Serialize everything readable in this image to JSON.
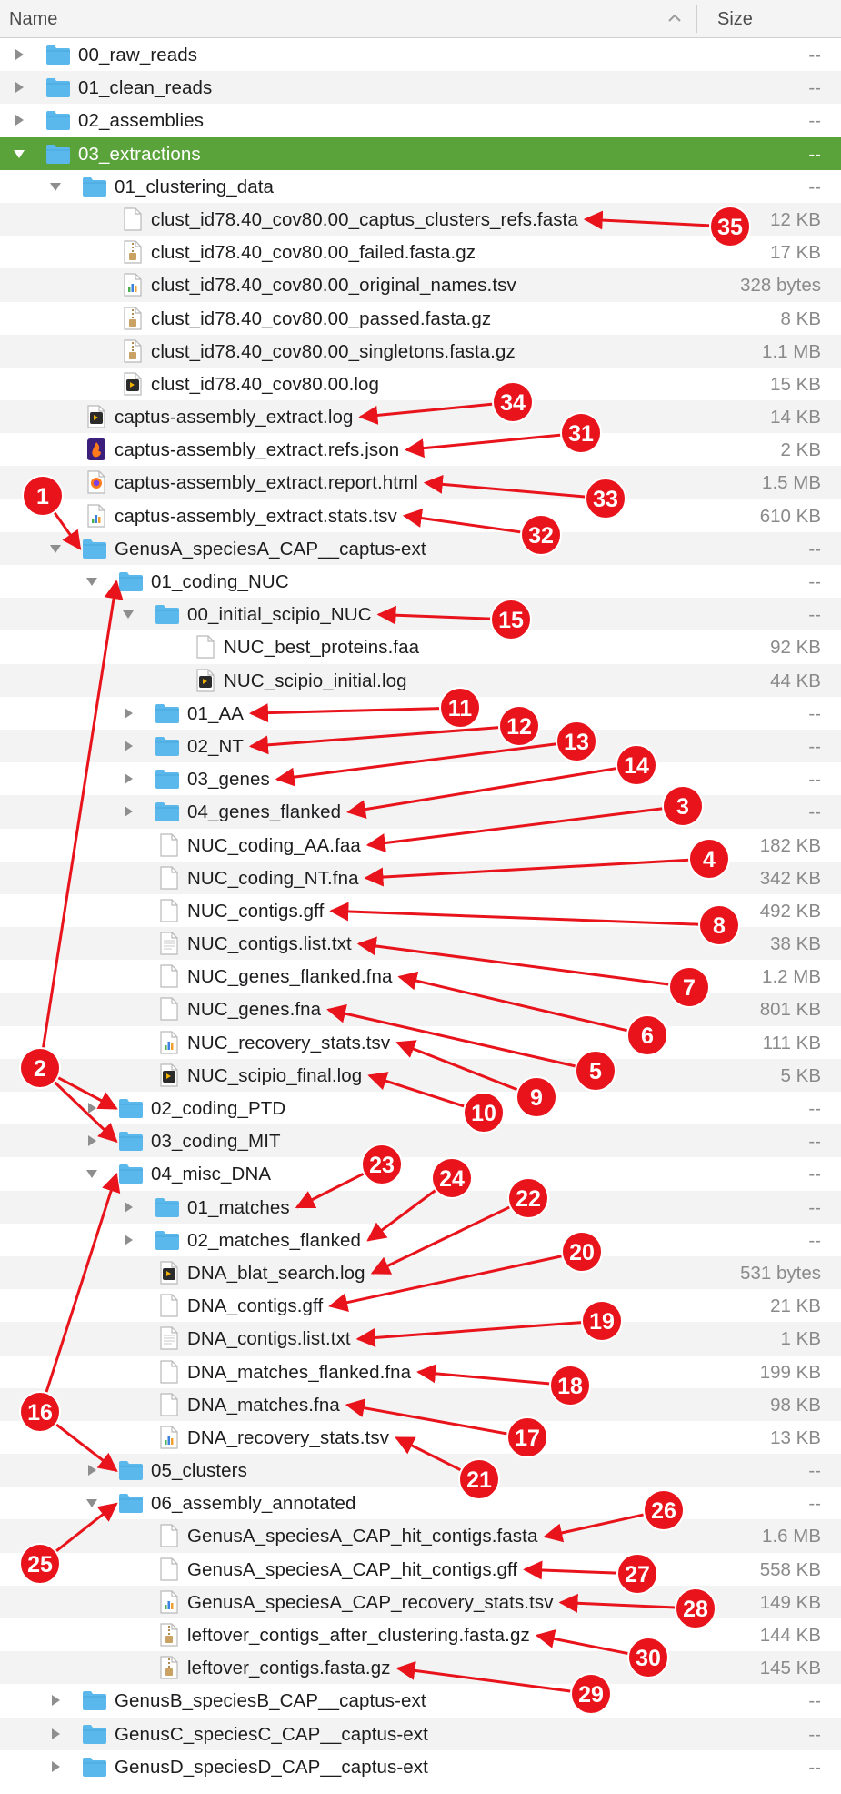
{
  "header": {
    "name_label": "Name",
    "size_label": "Size"
  },
  "colors": {
    "selection": "#5aa33b",
    "folder": "#5ab8ec",
    "badge": "#e8131b",
    "arrow": "#e8131b"
  },
  "rows": [
    {
      "name": "00_raw_reads",
      "size": "--",
      "type": "folder",
      "level": 0,
      "disc": "closed"
    },
    {
      "name": "01_clean_reads",
      "size": "--",
      "type": "folder",
      "level": 0,
      "disc": "closed"
    },
    {
      "name": "02_assemblies",
      "size": "--",
      "type": "folder",
      "level": 0,
      "disc": "closed"
    },
    {
      "name": "03_extractions",
      "size": "--",
      "type": "folder",
      "level": 0,
      "disc": "open",
      "selected": true
    },
    {
      "name": "01_clustering_data",
      "size": "--",
      "type": "folder",
      "level": 1,
      "disc": "open"
    },
    {
      "name": "clust_id78.40_cov80.00_captus_clusters_refs.fasta",
      "size": "12 KB",
      "type": "doc",
      "level": 2,
      "disc": "none"
    },
    {
      "name": "clust_id78.40_cov80.00_failed.fasta.gz",
      "size": "17 KB",
      "type": "archive",
      "level": 2,
      "disc": "none"
    },
    {
      "name": "clust_id78.40_cov80.00_original_names.tsv",
      "size": "328 bytes",
      "type": "table",
      "level": 2,
      "disc": "none"
    },
    {
      "name": "clust_id78.40_cov80.00_passed.fasta.gz",
      "size": "8 KB",
      "type": "archive",
      "level": 2,
      "disc": "none"
    },
    {
      "name": "clust_id78.40_cov80.00_singletons.fasta.gz",
      "size": "1.1 MB",
      "type": "archive",
      "level": 2,
      "disc": "none"
    },
    {
      "name": "clust_id78.40_cov80.00.log",
      "size": "15 KB",
      "type": "log",
      "level": 2,
      "disc": "none"
    },
    {
      "name": "captus-assembly_extract.log",
      "size": "14 KB",
      "type": "log",
      "level": 1,
      "disc": "none"
    },
    {
      "name": "captus-assembly_extract.refs.json",
      "size": "2 KB",
      "type": "json",
      "level": 1,
      "disc": "none"
    },
    {
      "name": "captus-assembly_extract.report.html",
      "size": "1.5 MB",
      "type": "html",
      "level": 1,
      "disc": "none"
    },
    {
      "name": "captus-assembly_extract.stats.tsv",
      "size": "610 KB",
      "type": "table",
      "level": 1,
      "disc": "none"
    },
    {
      "name": "GenusA_speciesA_CAP__captus-ext",
      "size": "--",
      "type": "folder",
      "level": 1,
      "disc": "open"
    },
    {
      "name": "01_coding_NUC",
      "size": "--",
      "type": "folder",
      "level": 2,
      "disc": "open"
    },
    {
      "name": "00_initial_scipio_NUC",
      "size": "--",
      "type": "folder",
      "level": 3,
      "disc": "open"
    },
    {
      "name": "NUC_best_proteins.faa",
      "size": "92 KB",
      "type": "doc",
      "level": 4,
      "disc": "none"
    },
    {
      "name": "NUC_scipio_initial.log",
      "size": "44 KB",
      "type": "log",
      "level": 4,
      "disc": "none"
    },
    {
      "name": "01_AA",
      "size": "--",
      "type": "folder",
      "level": 3,
      "disc": "closed"
    },
    {
      "name": "02_NT",
      "size": "--",
      "type": "folder",
      "level": 3,
      "disc": "closed"
    },
    {
      "name": "03_genes",
      "size": "--",
      "type": "folder",
      "level": 3,
      "disc": "closed"
    },
    {
      "name": "04_genes_flanked",
      "size": "--",
      "type": "folder",
      "level": 3,
      "disc": "closed"
    },
    {
      "name": "NUC_coding_AA.faa",
      "size": "182 KB",
      "type": "doc",
      "level": 3,
      "disc": "none"
    },
    {
      "name": "NUC_coding_NT.fna",
      "size": "342 KB",
      "type": "doc",
      "level": 3,
      "disc": "none"
    },
    {
      "name": "NUC_contigs.gff",
      "size": "492 KB",
      "type": "doc",
      "level": 3,
      "disc": "none"
    },
    {
      "name": "NUC_contigs.list.txt",
      "size": "38 KB",
      "type": "text",
      "level": 3,
      "disc": "none"
    },
    {
      "name": "NUC_genes_flanked.fna",
      "size": "1.2 MB",
      "type": "doc",
      "level": 3,
      "disc": "none"
    },
    {
      "name": "NUC_genes.fna",
      "size": "801 KB",
      "type": "doc",
      "level": 3,
      "disc": "none"
    },
    {
      "name": "NUC_recovery_stats.tsv",
      "size": "111 KB",
      "type": "table",
      "level": 3,
      "disc": "none"
    },
    {
      "name": "NUC_scipio_final.log",
      "size": "5 KB",
      "type": "log",
      "level": 3,
      "disc": "none"
    },
    {
      "name": "02_coding_PTD",
      "size": "--",
      "type": "folder",
      "level": 2,
      "disc": "closed"
    },
    {
      "name": "03_coding_MIT",
      "size": "--",
      "type": "folder",
      "level": 2,
      "disc": "closed"
    },
    {
      "name": "04_misc_DNA",
      "size": "--",
      "type": "folder",
      "level": 2,
      "disc": "open"
    },
    {
      "name": "01_matches",
      "size": "--",
      "type": "folder",
      "level": 3,
      "disc": "closed"
    },
    {
      "name": "02_matches_flanked",
      "size": "--",
      "type": "folder",
      "level": 3,
      "disc": "closed"
    },
    {
      "name": "DNA_blat_search.log",
      "size": "531 bytes",
      "type": "log",
      "level": 3,
      "disc": "none"
    },
    {
      "name": "DNA_contigs.gff",
      "size": "21 KB",
      "type": "doc",
      "level": 3,
      "disc": "none"
    },
    {
      "name": "DNA_contigs.list.txt",
      "size": "1 KB",
      "type": "text",
      "level": 3,
      "disc": "none"
    },
    {
      "name": "DNA_matches_flanked.fna",
      "size": "199 KB",
      "type": "doc",
      "level": 3,
      "disc": "none"
    },
    {
      "name": "DNA_matches.fna",
      "size": "98 KB",
      "type": "doc",
      "level": 3,
      "disc": "none"
    },
    {
      "name": "DNA_recovery_stats.tsv",
      "size": "13 KB",
      "type": "table",
      "level": 3,
      "disc": "none"
    },
    {
      "name": "05_clusters",
      "size": "--",
      "type": "folder",
      "level": 2,
      "disc": "closed"
    },
    {
      "name": "06_assembly_annotated",
      "size": "--",
      "type": "folder",
      "level": 2,
      "disc": "open"
    },
    {
      "name": "GenusA_speciesA_CAP_hit_contigs.fasta",
      "size": "1.6 MB",
      "type": "doc",
      "level": 3,
      "disc": "none"
    },
    {
      "name": "GenusA_speciesA_CAP_hit_contigs.gff",
      "size": "558 KB",
      "type": "doc",
      "level": 3,
      "disc": "none"
    },
    {
      "name": "GenusA_speciesA_CAP_recovery_stats.tsv",
      "size": "149 KB",
      "type": "table",
      "level": 3,
      "disc": "none"
    },
    {
      "name": "leftover_contigs_after_clustering.fasta.gz",
      "size": "144 KB",
      "type": "archive",
      "level": 3,
      "disc": "none"
    },
    {
      "name": "leftover_contigs.fasta.gz",
      "size": "145 KB",
      "type": "archive",
      "level": 3,
      "disc": "none"
    },
    {
      "name": "GenusB_speciesB_CAP__captus-ext",
      "size": "--",
      "type": "folder",
      "level": 1,
      "disc": "closed"
    },
    {
      "name": "GenusC_speciesC_CAP__captus-ext",
      "size": "--",
      "type": "folder",
      "level": 1,
      "disc": "closed"
    },
    {
      "name": "GenusD_speciesD_CAP__captus-ext",
      "size": "--",
      "type": "folder",
      "level": 1,
      "disc": "closed"
    }
  ],
  "annotations": [
    {
      "label": "35",
      "targets": [
        5
      ]
    },
    {
      "label": "34",
      "targets": [
        11
      ]
    },
    {
      "label": "31",
      "targets": [
        12
      ]
    },
    {
      "label": "33",
      "targets": [
        13
      ]
    },
    {
      "label": "32",
      "targets": [
        14
      ]
    },
    {
      "label": "1",
      "targets": [
        15
      ]
    },
    {
      "label": "15",
      "targets": [
        17
      ]
    },
    {
      "label": "11",
      "targets": [
        20
      ]
    },
    {
      "label": "12",
      "targets": [
        21
      ]
    },
    {
      "label": "13",
      "targets": [
        22
      ]
    },
    {
      "label": "14",
      "targets": [
        23
      ]
    },
    {
      "label": "3",
      "targets": [
        24
      ]
    },
    {
      "label": "4",
      "targets": [
        25
      ]
    },
    {
      "label": "8",
      "targets": [
        26
      ]
    },
    {
      "label": "7",
      "targets": [
        27
      ]
    },
    {
      "label": "6",
      "targets": [
        28
      ]
    },
    {
      "label": "5",
      "targets": [
        29
      ]
    },
    {
      "label": "9",
      "targets": [
        30
      ]
    },
    {
      "label": "10",
      "targets": [
        31
      ]
    },
    {
      "label": "2",
      "targets": [
        16,
        32,
        33
      ]
    },
    {
      "label": "23",
      "targets": [
        35
      ]
    },
    {
      "label": "24",
      "targets": [
        36
      ]
    },
    {
      "label": "22",
      "targets": [
        37
      ]
    },
    {
      "label": "20",
      "targets": [
        38
      ]
    },
    {
      "label": "19",
      "targets": [
        39
      ]
    },
    {
      "label": "18",
      "targets": [
        40
      ]
    },
    {
      "label": "17",
      "targets": [
        41
      ]
    },
    {
      "label": "21",
      "targets": [
        42
      ]
    },
    {
      "label": "16",
      "targets": [
        34,
        43
      ]
    },
    {
      "label": "25",
      "targets": [
        44
      ]
    },
    {
      "label": "26",
      "targets": [
        45
      ]
    },
    {
      "label": "27",
      "targets": [
        46
      ]
    },
    {
      "label": "28",
      "targets": [
        47
      ]
    },
    {
      "label": "30",
      "targets": [
        48
      ]
    },
    {
      "label": "29",
      "targets": [
        49
      ]
    }
  ]
}
